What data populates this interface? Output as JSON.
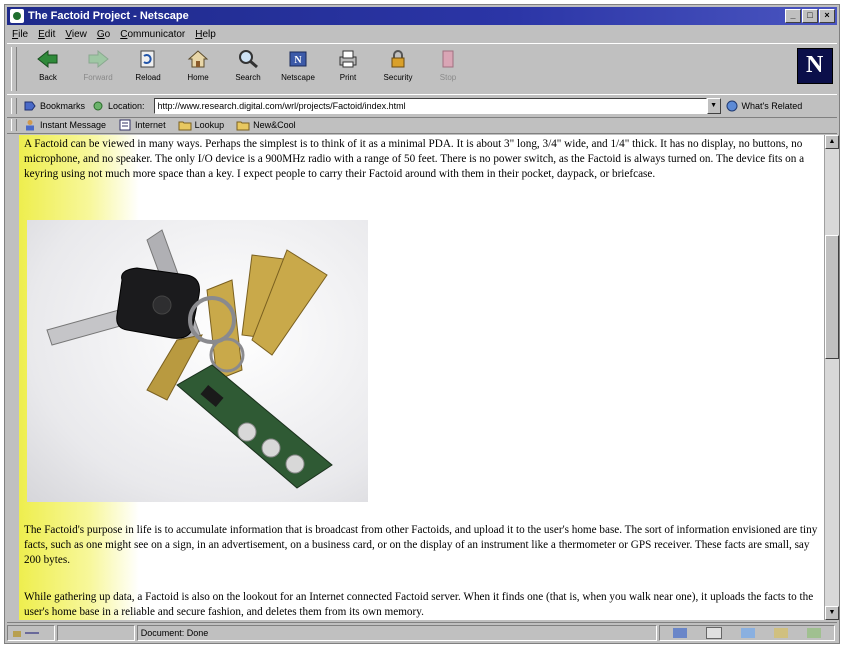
{
  "window": {
    "title": "The Factoid Project - Netscape"
  },
  "menu": [
    "File",
    "Edit",
    "View",
    "Go",
    "Communicator",
    "Help"
  ],
  "toolbar": {
    "buttons": [
      {
        "label": "Back"
      },
      {
        "label": "Forward"
      },
      {
        "label": "Reload"
      },
      {
        "label": "Home"
      },
      {
        "label": "Search"
      },
      {
        "label": "Netscape"
      },
      {
        "label": "Print"
      },
      {
        "label": "Security"
      },
      {
        "label": "Stop"
      }
    ]
  },
  "location": {
    "bookmarks_label": "Bookmarks",
    "location_label": "Location:",
    "url": "http://www.research.digital.com/wrl/projects/Factoid/index.html",
    "related_label": "What's Related"
  },
  "personal_toolbar": [
    "Instant Message",
    "Internet",
    "Lookup",
    "New&Cool"
  ],
  "content": {
    "para1": "A Factoid can be viewed in many ways. Perhaps the simplest is to think of it as a minimal PDA. It is about 3\" long, 3/4\" wide, and 1/4\" thick. It has no display, no buttons, no microphone, and no speaker. The only I/O device is a 900MHz radio with a range of 50 feet. There is no power switch, as the Factoid is always turned on. The device fits on a keyring using not much more space than a key. I expect people to carry their Factoid around with them in their pocket, daypack, or briefcase.",
    "para2": "The Factoid's purpose in life is to accumulate information that is broadcast from other Factoids, and upload it to the user's home base. The sort of information envisioned are tiny facts, such as one might see on a sign, in an advertisement, on a business card, or on the display of an instrument like a thermometer or GPS receiver. These facts are small, say 200 bytes.",
    "para3": "While gathering up data, a Factoid is also on the lookout for an Internet connected Factoid server. When it finds one (that is, when you walk near one), it uploads the facts to the user's home base in a reliable and secure fashion, and deletes them from its own memory."
  },
  "status": {
    "text": "Document: Done"
  }
}
